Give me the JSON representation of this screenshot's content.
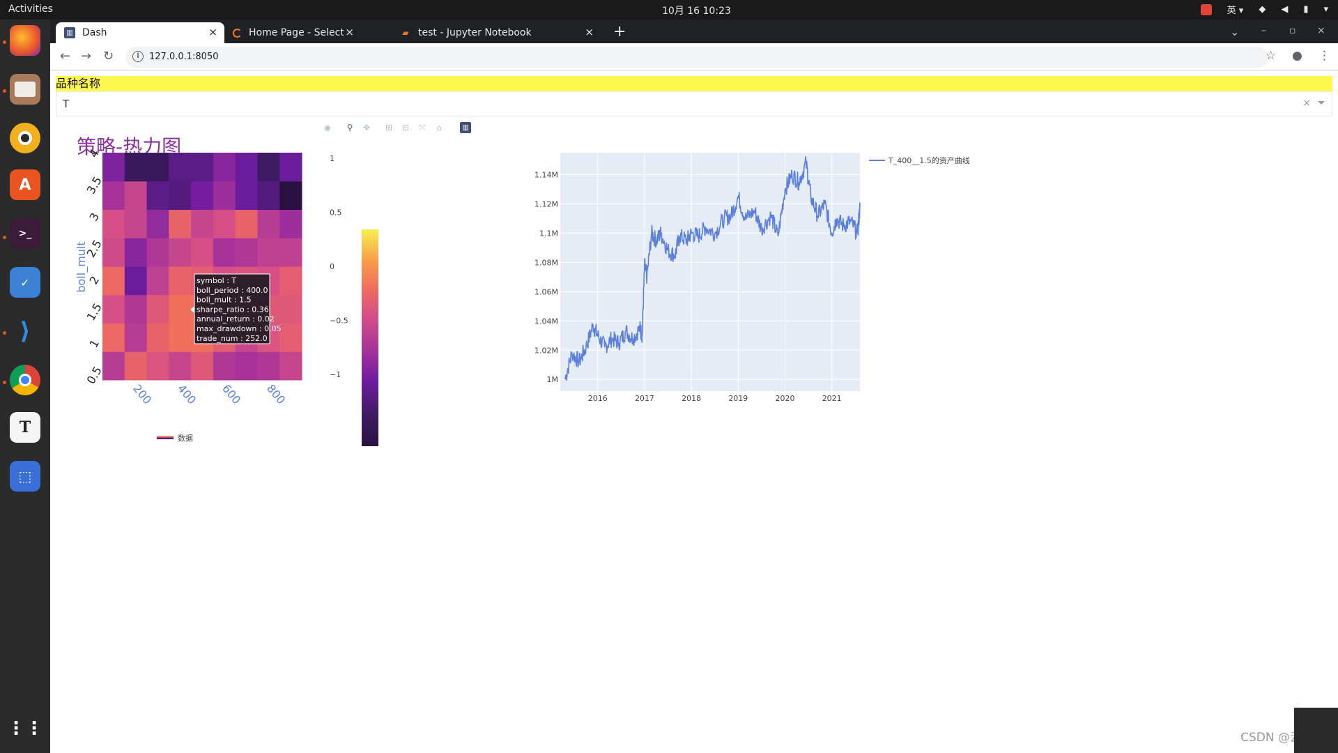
{
  "topbar": {
    "activities": "Activities",
    "clock": "10月 16  10:23",
    "input_method": "英 ▾"
  },
  "browser": {
    "tabs": [
      {
        "title": "Dash",
        "icon": "dash-plot-icon",
        "active": true
      },
      {
        "title": "Home Page - Select or cre",
        "icon": "jupyter-spinner-icon",
        "active": false
      },
      {
        "title": "test - Jupyter Notebook",
        "icon": "notebook-icon",
        "active": false
      }
    ],
    "url": "127.0.0.1:8050"
  },
  "page": {
    "dropdown_label": "品种名称",
    "dropdown_value": "T",
    "title": "策略-热力图"
  },
  "heatmap": {
    "type": "heatmap",
    "x_label": "boll_period",
    "y_label": "boll_mult",
    "x_ticks": [
      "200",
      "400",
      "600",
      "800"
    ],
    "y_ticks": [
      "0.5",
      "1",
      "1.5",
      "2",
      "2.5",
      "3",
      "3.5",
      "4"
    ],
    "colorbar_ticks": [
      "1",
      "0.5",
      "0",
      "−0.5",
      "−1"
    ],
    "colorbar_range": [
      -1,
      1
    ],
    "legend_label": "数据",
    "colorscale": [
      "#2b1142",
      "#3f1b66",
      "#6e1ca0",
      "#a8349a",
      "#d54e88",
      "#ee6b5e",
      "#f99b4a",
      "#f6ef4c"
    ],
    "values": [
      [
        -0.05,
        0.35,
        0.2,
        0.05,
        0.25,
        -0.1,
        -0.15,
        -0.1,
        0.05
      ],
      [
        0.4,
        -0.05,
        0.35,
        0.45,
        0.45,
        0.3,
        0.05,
        0.2,
        0.3
      ],
      [
        0.15,
        -0.1,
        0.25,
        0.45,
        0.45,
        0.3,
        0.1,
        0.25,
        0.25
      ],
      [
        0.4,
        -0.45,
        0.0,
        0.35,
        0.3,
        0.15,
        0.2,
        0.15,
        0.3
      ],
      [
        0.1,
        -0.3,
        -0.1,
        0.05,
        0.15,
        -0.15,
        -0.1,
        0.0,
        0.0
      ],
      [
        0.15,
        0.05,
        -0.25,
        0.35,
        0.05,
        0.15,
        0.35,
        -0.05,
        -0.2
      ],
      [
        -0.15,
        0.05,
        -0.55,
        -0.6,
        -0.4,
        -0.2,
        -0.45,
        -0.6,
        -1.0
      ],
      [
        -0.35,
        -0.8,
        -0.8,
        -0.55,
        -0.55,
        -0.3,
        -0.45,
        -0.75,
        -0.45
      ]
    ],
    "tooltip": [
      "symbol : T",
      "boll_period : 400.0",
      "boll_mult : 1.5",
      "sharpe_ratio : 0.36",
      "annual_return : 0.02",
      "max_drawdown : 0.05",
      "trade_num : 252.0"
    ]
  },
  "chart_data": {
    "type": "line",
    "series": [
      {
        "name": "T_400__1.5的资产曲线",
        "color": "#5b7fdc",
        "x": [
          2015.3,
          2015.45,
          2015.6,
          2015.75,
          2015.9,
          2016.0,
          2016.15,
          2016.3,
          2016.45,
          2016.6,
          2016.75,
          2016.9,
          2016.95,
          2017.0,
          2017.05,
          2017.15,
          2017.25,
          2017.35,
          2017.5,
          2017.65,
          2017.75,
          2017.9,
          2018.0,
          2018.15,
          2018.3,
          2018.5,
          2018.7,
          2018.85,
          2019.0,
          2019.15,
          2019.35,
          2019.5,
          2019.7,
          2019.85,
          2020.0,
          2020.15,
          2020.3,
          2020.45,
          2020.55,
          2020.7,
          2020.85,
          2021.0,
          2021.1,
          2021.25,
          2021.4,
          2021.55,
          2021.6
        ],
        "y": [
          1.0,
          1.018,
          1.012,
          1.022,
          1.037,
          1.03,
          1.022,
          1.028,
          1.025,
          1.033,
          1.028,
          1.035,
          1.03,
          1.078,
          1.07,
          1.1,
          1.095,
          1.1,
          1.088,
          1.085,
          1.098,
          1.095,
          1.1,
          1.098,
          1.104,
          1.1,
          1.11,
          1.112,
          1.125,
          1.11,
          1.115,
          1.103,
          1.112,
          1.098,
          1.13,
          1.14,
          1.135,
          1.148,
          1.125,
          1.112,
          1.12,
          1.1,
          1.11,
          1.105,
          1.108,
          1.1,
          1.118
        ]
      }
    ],
    "x_ticks": [
      "2016",
      "2017",
      "2018",
      "2019",
      "2020",
      "2021"
    ],
    "y_ticks": [
      "1M",
      "1.02M",
      "1.04M",
      "1.06M",
      "1.08M",
      "1.1M",
      "1.12M",
      "1.14M"
    ],
    "xlim": [
      2015.2,
      2021.6
    ],
    "ylim": [
      0.992,
      1.155
    ],
    "legend_placement": "top-right",
    "grid": true
  },
  "watermark": "CSDN @云金杞"
}
